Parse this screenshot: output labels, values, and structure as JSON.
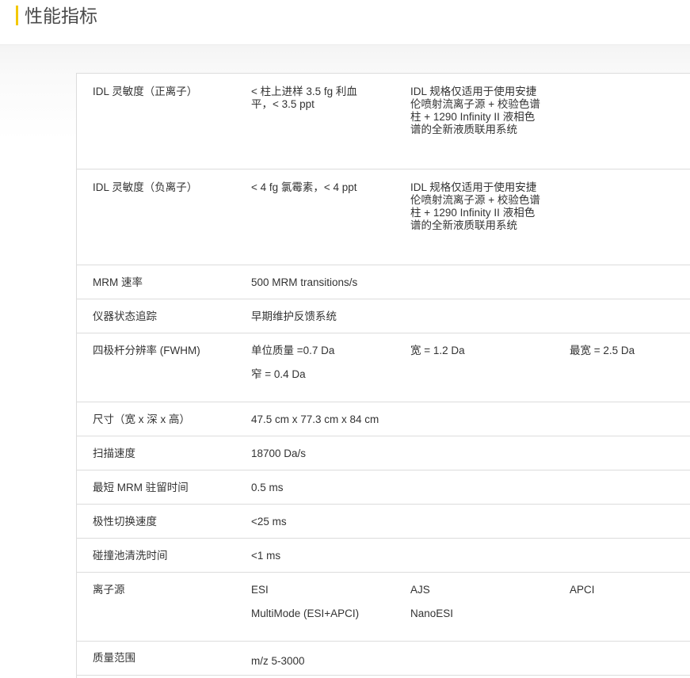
{
  "header": {
    "title": "性能指标"
  },
  "rows": [
    {
      "label": "IDL 灵敏度（正离子）",
      "v1": "< 柱上进样 3.5 fg 利血平，< 3.5 ppt",
      "v2": "IDL 规格仅适用于使用安捷伦喷射流离子源 + 校验色谱柱 + 1290 Infinity II 液相色谱的全新液质联用系统"
    },
    {
      "label": "IDL 灵敏度（负离子）",
      "v1": "< 4 fg 氯霉素，< 4 ppt",
      "v2": "IDL 规格仅适用于使用安捷伦喷射流离子源 + 校验色谱柱 + 1290 Infinity II 液相色谱的全新液质联用系统"
    },
    {
      "label": "MRM 速率",
      "v1": "500 MRM transitions/s"
    },
    {
      "label": "仪器状态追踪",
      "v1": "早期维护反馈系统"
    },
    {
      "label": "四极杆分辨率 (FWHM)",
      "v1": "单位质量 =0.7 Da",
      "v1b": "窄 = 0.4 Da",
      "v2": "宽 = 1.2 Da",
      "v3": "最宽 = 2.5 Da"
    },
    {
      "label": "尺寸（宽 x 深 x 高）",
      "v1": "47.5 cm x 77.3 cm x 84 cm"
    },
    {
      "label": "扫描速度",
      "v1": "18700 Da/s"
    },
    {
      "label": "最短 MRM 驻留时间",
      "v1": "0.5 ms"
    },
    {
      "label": "极性切换速度",
      "v1": "<25 ms"
    },
    {
      "label": "碰撞池清洗时间",
      "v1": "<1 ms"
    },
    {
      "label": "离子源",
      "v1": "ESI",
      "v1b": "MultiMode (ESI+APCI)",
      "v2": "AJS",
      "v2b": "NanoESI",
      "v3": "APCI"
    },
    {
      "label": "质量范围",
      "v1": "m/z 5-3000"
    }
  ]
}
